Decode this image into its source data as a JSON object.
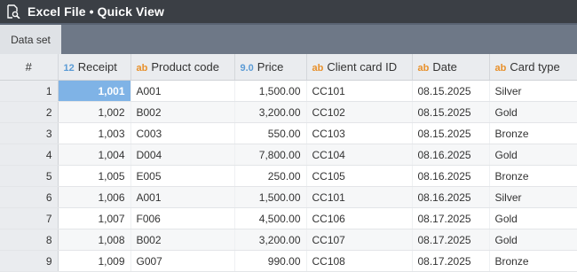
{
  "title": "Excel File • Quick View",
  "tabs": [
    {
      "label": "Data set"
    }
  ],
  "columns": [
    {
      "label": "#",
      "type_icon": ""
    },
    {
      "label": "Receipt",
      "type_icon": "12"
    },
    {
      "label": "Product code",
      "type_icon": "ab"
    },
    {
      "label": "Price",
      "type_icon": "9.0"
    },
    {
      "label": "Client card ID",
      "type_icon": "ab"
    },
    {
      "label": "Date",
      "type_icon": "ab"
    },
    {
      "label": "Card type",
      "type_icon": "ab"
    }
  ],
  "rows": [
    {
      "n": "1",
      "receipt": "1,001",
      "product": "A001",
      "price": "1,500.00",
      "card": "CC101",
      "date": "08.15.2025",
      "type": "Silver"
    },
    {
      "n": "2",
      "receipt": "1,002",
      "product": "B002",
      "price": "3,200.00",
      "card": "CC102",
      "date": "08.15.2025",
      "type": "Gold"
    },
    {
      "n": "3",
      "receipt": "1,003",
      "product": "C003",
      "price": "550.00",
      "card": "CC103",
      "date": "08.15.2025",
      "type": "Bronze"
    },
    {
      "n": "4",
      "receipt": "1,004",
      "product": "D004",
      "price": "7,800.00",
      "card": "CC104",
      "date": "08.16.2025",
      "type": "Gold"
    },
    {
      "n": "5",
      "receipt": "1,005",
      "product": "E005",
      "price": "250.00",
      "card": "CC105",
      "date": "08.16.2025",
      "type": "Bronze"
    },
    {
      "n": "6",
      "receipt": "1,006",
      "product": "A001",
      "price": "1,500.00",
      "card": "CC101",
      "date": "08.16.2025",
      "type": "Silver"
    },
    {
      "n": "7",
      "receipt": "1,007",
      "product": "F006",
      "price": "4,500.00",
      "card": "CC106",
      "date": "08.17.2025",
      "type": "Gold"
    },
    {
      "n": "8",
      "receipt": "1,008",
      "product": "B002",
      "price": "3,200.00",
      "card": "CC107",
      "date": "08.17.2025",
      "type": "Gold"
    },
    {
      "n": "9",
      "receipt": "1,009",
      "product": "G007",
      "price": "990.00",
      "card": "CC108",
      "date": "08.17.2025",
      "type": "Bronze"
    }
  ],
  "colors": {
    "titlebar": "#3b3f45",
    "tabbar": "#6e7887",
    "selected": "#7fb3e6",
    "text_type": "#e8902a",
    "num_type": "#5b9bd5"
  },
  "icons": {
    "title": "search-document-icon"
  }
}
